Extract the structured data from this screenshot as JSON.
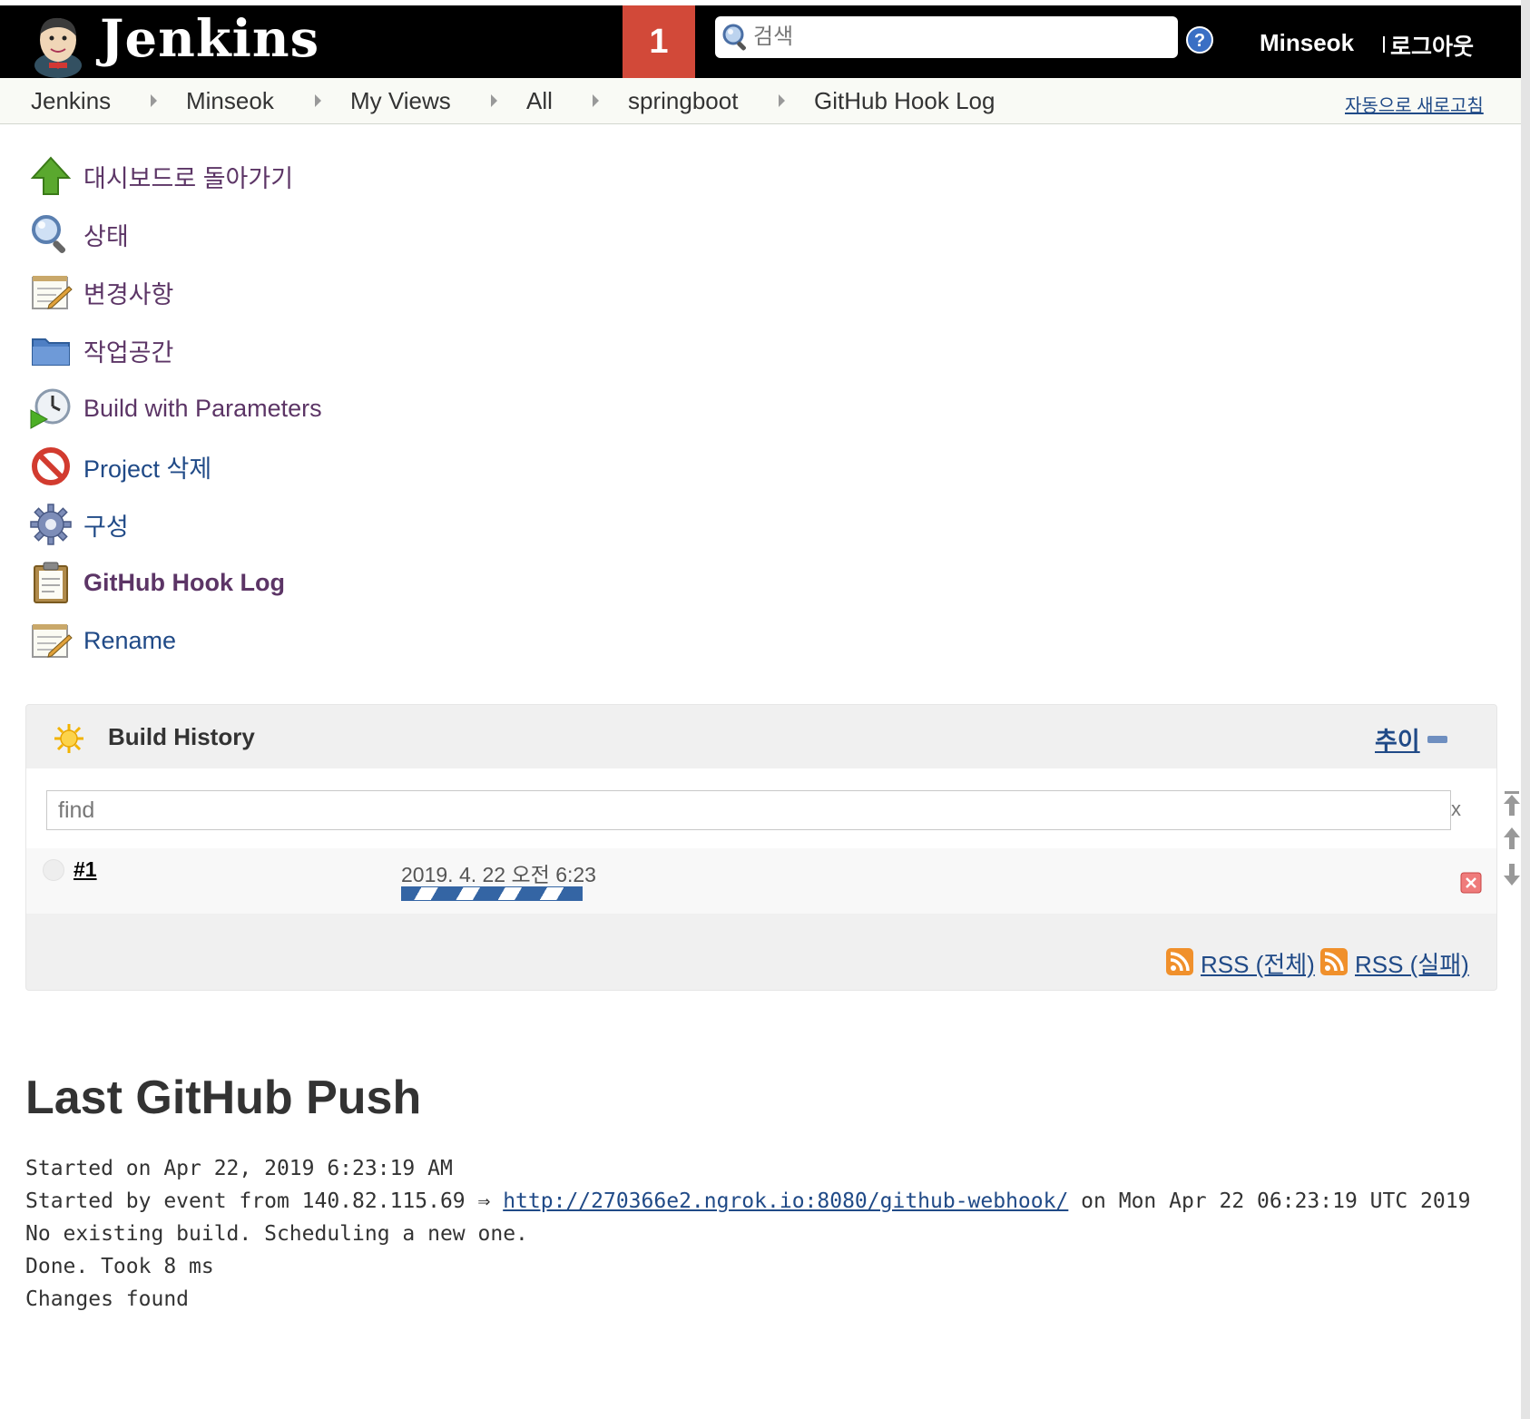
{
  "header": {
    "logo_text": "Jenkins",
    "notification_count": "1",
    "search_placeholder": "검색",
    "user": "Minseok",
    "logout": "로그아웃"
  },
  "breadcrumb": {
    "items": [
      "Jenkins",
      "Minseok",
      "My Views",
      "All",
      "springboot",
      "GitHub Hook Log"
    ],
    "auto_refresh": "자동으로 새로고침"
  },
  "tasks": [
    {
      "label": "대시보드로 돌아가기",
      "icon": "up-arrow-icon"
    },
    {
      "label": "상태",
      "icon": "magnifier-icon"
    },
    {
      "label": "변경사항",
      "icon": "notepad-icon"
    },
    {
      "label": "작업공간",
      "icon": "folder-icon"
    },
    {
      "label": "Build with Parameters",
      "icon": "clock-play-icon"
    },
    {
      "label": "Project 삭제",
      "icon": "no-entry-icon"
    },
    {
      "label": "구성",
      "icon": "gear-icon"
    },
    {
      "label": "GitHub Hook Log",
      "icon": "clipboard-icon"
    },
    {
      "label": "Rename",
      "icon": "notepad-icon"
    }
  ],
  "build_history": {
    "title": "Build History",
    "trend": "추이",
    "find_placeholder": "find",
    "clear": "x",
    "builds": [
      {
        "number": "#1",
        "date": "2019. 4. 22 오전 6:23",
        "status": "in-progress"
      }
    ],
    "rss_all": "RSS (전체)",
    "rss_failed": "RSS (실패)"
  },
  "last_push": {
    "title": "Last GitHub Push",
    "line1": "Started on Apr 22, 2019 6:23:19 AM",
    "line2_prefix": "Started by event from 140.82.115.69 ⇒ ",
    "line2_link": "http://270366e2.ngrok.io:8080/github-webhook/",
    "line2_suffix": " on Mon Apr 22 06:23:19 UTC 2019",
    "line3": "No existing build. Scheduling a new one.",
    "line4": "Done. Took 8 ms",
    "line5": "Changes found"
  },
  "colors": {
    "header_bg": "#000000",
    "notification_bg": "#d24939",
    "link_blue": "#204a87",
    "visited_purple": "#5c3566"
  }
}
